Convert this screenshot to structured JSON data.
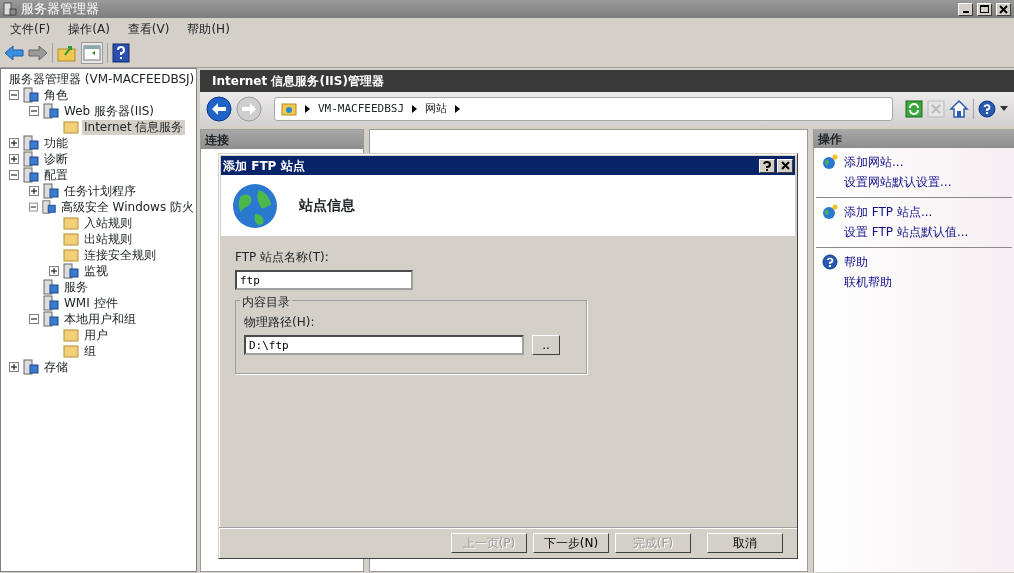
{
  "window": {
    "title": "服务器管理器"
  },
  "menu": [
    "文件(F)",
    "操作(A)",
    "查看(V)",
    "帮助(H)"
  ],
  "tree": [
    {
      "label": "服务器管理器 (VM-MACFEEDBSJ)",
      "selected": false,
      "children": [
        {
          "label": "角色",
          "selected": false,
          "expanded": true,
          "children": [
            {
              "label": "Web 服务器(IIS)",
              "selected": false,
              "expanded": true,
              "children": [
                {
                  "label": "Internet 信息服务",
                  "selected": true
                }
              ]
            }
          ]
        },
        {
          "label": "功能",
          "selected": false,
          "expanded": false
        },
        {
          "label": "诊断",
          "selected": false,
          "expanded": false
        },
        {
          "label": "配置",
          "selected": false,
          "expanded": true,
          "children": [
            {
              "label": "任务计划程序",
              "selected": false,
              "expanded": false
            },
            {
              "label": "高级安全 Windows 防火",
              "selected": false,
              "expanded": true,
              "children": [
                {
                  "label": "入站规则",
                  "selected": false
                },
                {
                  "label": "出站规则",
                  "selected": false
                },
                {
                  "label": "连接安全规则",
                  "selected": false
                },
                {
                  "label": "监视",
                  "selected": false,
                  "expanded": false
                }
              ]
            },
            {
              "label": "服务",
              "selected": false
            },
            {
              "label": "WMI 控件",
              "selected": false
            },
            {
              "label": "本地用户和组",
              "selected": false,
              "expanded": true,
              "children": [
                {
                  "label": "用户",
                  "selected": false
                },
                {
                  "label": "组",
                  "selected": false
                }
              ]
            }
          ]
        },
        {
          "label": "存储",
          "selected": false,
          "expanded": false
        }
      ]
    }
  ],
  "iis": {
    "title": "Internet 信息服务(IIS)管理器",
    "breadcrumb": [
      "VM-MACFEEDBSJ",
      "网站"
    ],
    "connections": {
      "title": "连接"
    },
    "actions": {
      "title": "操作",
      "groups": [
        {
          "items": [
            {
              "label": "添加网站..."
            },
            {
              "label": "设置网站默认设置..."
            }
          ]
        },
        {
          "items": [
            {
              "label": "添加 FTP 站点..."
            },
            {
              "label": "设置 FTP 站点默认值..."
            }
          ]
        },
        {
          "items": [
            {
              "label": "帮助"
            },
            {
              "label": "联机帮助"
            }
          ]
        }
      ]
    }
  },
  "dialog": {
    "title": "添加 FTP 站点",
    "heading": "站点信息",
    "site_name": {
      "label": "FTP 站点名称(T):",
      "value": "ftp"
    },
    "content_dir": {
      "legend": "内容目录",
      "path_label": "物理路径(H):",
      "path_value": "D:\\ftp",
      "browse": ".."
    },
    "buttons": [
      {
        "label": "上一页(P)",
        "disabled": true
      },
      {
        "label": "下一步(N)",
        "disabled": false
      },
      {
        "label": "完成(F)",
        "disabled": true
      },
      {
        "label": "取消",
        "disabled": false
      }
    ]
  }
}
